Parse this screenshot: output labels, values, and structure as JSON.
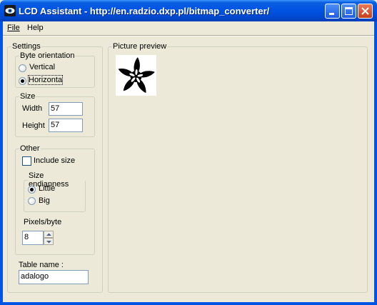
{
  "window": {
    "title": "LCD Assistant -  http://en.radzio.dxp.pl/bitmap_converter/",
    "icon": "eye-icon"
  },
  "menu": [
    {
      "label": "File",
      "accel": "F"
    },
    {
      "label": "Help",
      "accel": "H"
    }
  ],
  "settings": {
    "title": "Settings",
    "byte_orientation": {
      "title": "Byte orientation",
      "options": [
        "Vertical",
        "Horizonta"
      ],
      "selected": "Horizonta"
    },
    "size": {
      "title": "Size",
      "width_label": "Width",
      "width_value": "57",
      "height_label": "Height",
      "height_value": "57"
    },
    "other": {
      "title": "Other",
      "include_size_label": "Include size",
      "include_size_checked": false,
      "endianness": {
        "title": "Size endianness",
        "options": [
          "Little",
          "Big"
        ],
        "selected": "Little"
      },
      "pixels_per_byte_label": "Pixels/byte",
      "pixels_per_byte_value": "8"
    },
    "table_name_label": "Table name :",
    "table_name_value": "adalogo"
  },
  "preview": {
    "title": "Picture preview",
    "image": "flower-logo-bitmap"
  }
}
